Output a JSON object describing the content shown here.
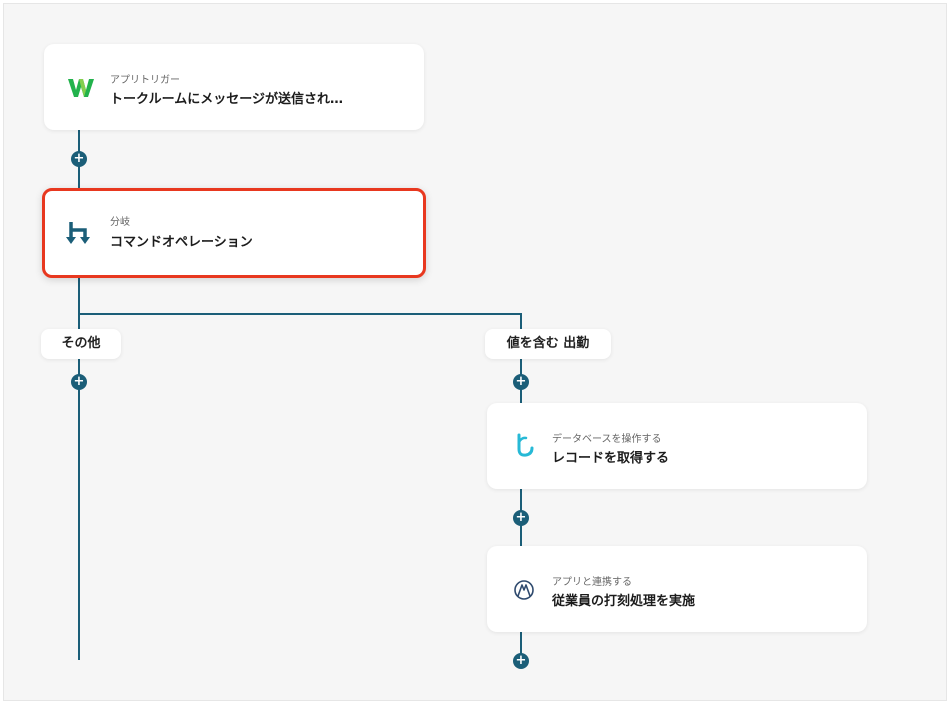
{
  "steps": {
    "trigger": {
      "subtitle": "アプリトリガー",
      "title": "トークルームにメッセージが送信され…",
      "icon": "w-logo-icon",
      "color": "#22b24c"
    },
    "branch": {
      "subtitle": "分岐",
      "title": "コマンドオペレーション",
      "icon": "branch-icon",
      "color": "#1b5e78"
    },
    "db": {
      "subtitle": "データベースを操作する",
      "title": "レコードを取得する",
      "icon": "database-icon",
      "color": "#27b9d6"
    },
    "app": {
      "subtitle": "アプリと連携する",
      "title": "従業員の打刻処理を実施",
      "icon": "app-logo-icon",
      "color": "#2f4a6e"
    }
  },
  "branches": {
    "other": "その他",
    "contains": "値を含む 出勤"
  },
  "colors": {
    "connector": "#1b5e78",
    "selected_border": "#e8381f",
    "canvas": "#f6f6f6"
  }
}
